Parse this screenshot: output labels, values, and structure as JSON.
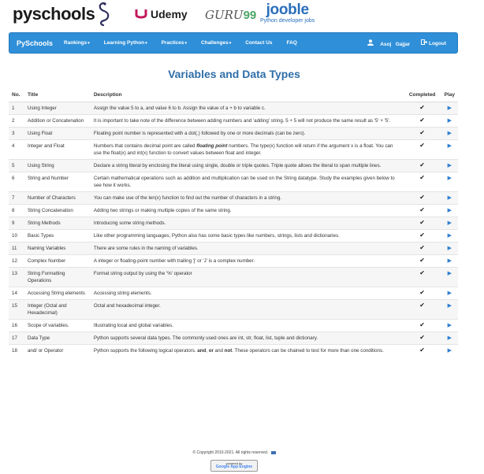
{
  "logos": {
    "pyschools": "pyschools",
    "udemy": "Udemy",
    "guru_text": "GURU",
    "guru_num": "99",
    "jooble": "jooble",
    "jooble_sub": "Python developer jobs"
  },
  "navbar": {
    "brand": "PySchools",
    "items": [
      "Rankings",
      "Learning Python",
      "Practices",
      "Challenges",
      "Contact Us",
      "FAQ"
    ],
    "dropdown_flags": [
      true,
      true,
      true,
      true,
      false,
      false
    ],
    "user": "Asoj   Gajjar",
    "logout": "Logout"
  },
  "page_title": "Variables and Data Types",
  "table": {
    "headers": [
      "No.",
      "Title",
      "Description",
      "Completed",
      "Play"
    ],
    "rows": [
      {
        "no": "1",
        "title": "Using Integer",
        "desc": "Assign the value 5 to a, and value 6 to b. Assign the value of a + b to variable c.",
        "done": true
      },
      {
        "no": "2",
        "title": "Addition or Concatenation",
        "desc": "It is important to take note of the difference between adding numbers and 'adding' string. 5 + 5 will not produce the same result as '5' + '5'.",
        "done": true
      },
      {
        "no": "3",
        "title": "Using Float",
        "desc": "Floating point number is represented with a dot(.) followed by one or more decimals (can be zero).",
        "done": true
      },
      {
        "no": "4",
        "title": "Integer and Float",
        "desc": "Numbers that contains decimal point are called floating point numbers. The type(x) function will return if the argument x is a float. You can use the float(x) and int(x) function to convert values between float and integer.",
        "done": true
      },
      {
        "no": "5",
        "title": "Using String",
        "desc": "Declare a string literal by enclosing the literal using single, double or triple quotes. Triple quote allows the literal to span multiple lines.",
        "done": true
      },
      {
        "no": "6",
        "title": "String and Number",
        "desc": "Certain mathematical operations such as addition and multiplication can be used on the String datatype. Study the examples given below to see how it works.",
        "done": true
      },
      {
        "no": "7",
        "title": "Number of Characters",
        "desc": "You can make use of the len(x) function to find out the number of characters in a string.",
        "done": true
      },
      {
        "no": "8",
        "title": "String Concatenation",
        "desc": "Adding two strings or making multiple copies of the same string.",
        "done": true
      },
      {
        "no": "9",
        "title": "String Methods",
        "desc": "Introducing some string methods.",
        "done": true
      },
      {
        "no": "10",
        "title": "Basic Types",
        "desc": "Like other programming languages, Python also has some basic types like numbers, strings, lists and dictionaries.",
        "done": true
      },
      {
        "no": "11",
        "title": "Naming Variables",
        "desc": "There are some rules in the naming of variables.",
        "done": true
      },
      {
        "no": "12",
        "title": "Complex Number",
        "desc": "A integer or floating-point number with trailing 'j' or 'J' is a complex number.",
        "done": true
      },
      {
        "no": "13",
        "title": "String Formatting Operations",
        "desc": "Format string output by using the '%' operator",
        "done": true
      },
      {
        "no": "14",
        "title": "Accessing String elements",
        "desc": "Accessing string elements.",
        "done": true
      },
      {
        "no": "15",
        "title": "Integer (Octal and Hexadecimal)",
        "desc": "Octal and hexadecimal integer.",
        "done": true
      },
      {
        "no": "16",
        "title": "Scope of variables.",
        "desc": "Illustrating local and global variables.",
        "done": true
      },
      {
        "no": "17",
        "title": "Data Type",
        "desc": "Python supports several data types. The commonly used ones are int, str, float, list, tuple and dictionary.",
        "done": true
      },
      {
        "no": "18",
        "title": "and/ or Operator",
        "desc": "Python supports the following logical operators. and, or and not. These operators can be chained to test for more than one conditions.",
        "done": true
      }
    ]
  },
  "footer": {
    "copyright": "© Copyright 2010-2021. All rights reserved.",
    "badge_line1": "powered by",
    "badge_line2": "Google App Engine"
  },
  "colors": {
    "navbar": "#2f8fd8",
    "title": "#2e6ea8",
    "play": "#2f7fd0"
  }
}
